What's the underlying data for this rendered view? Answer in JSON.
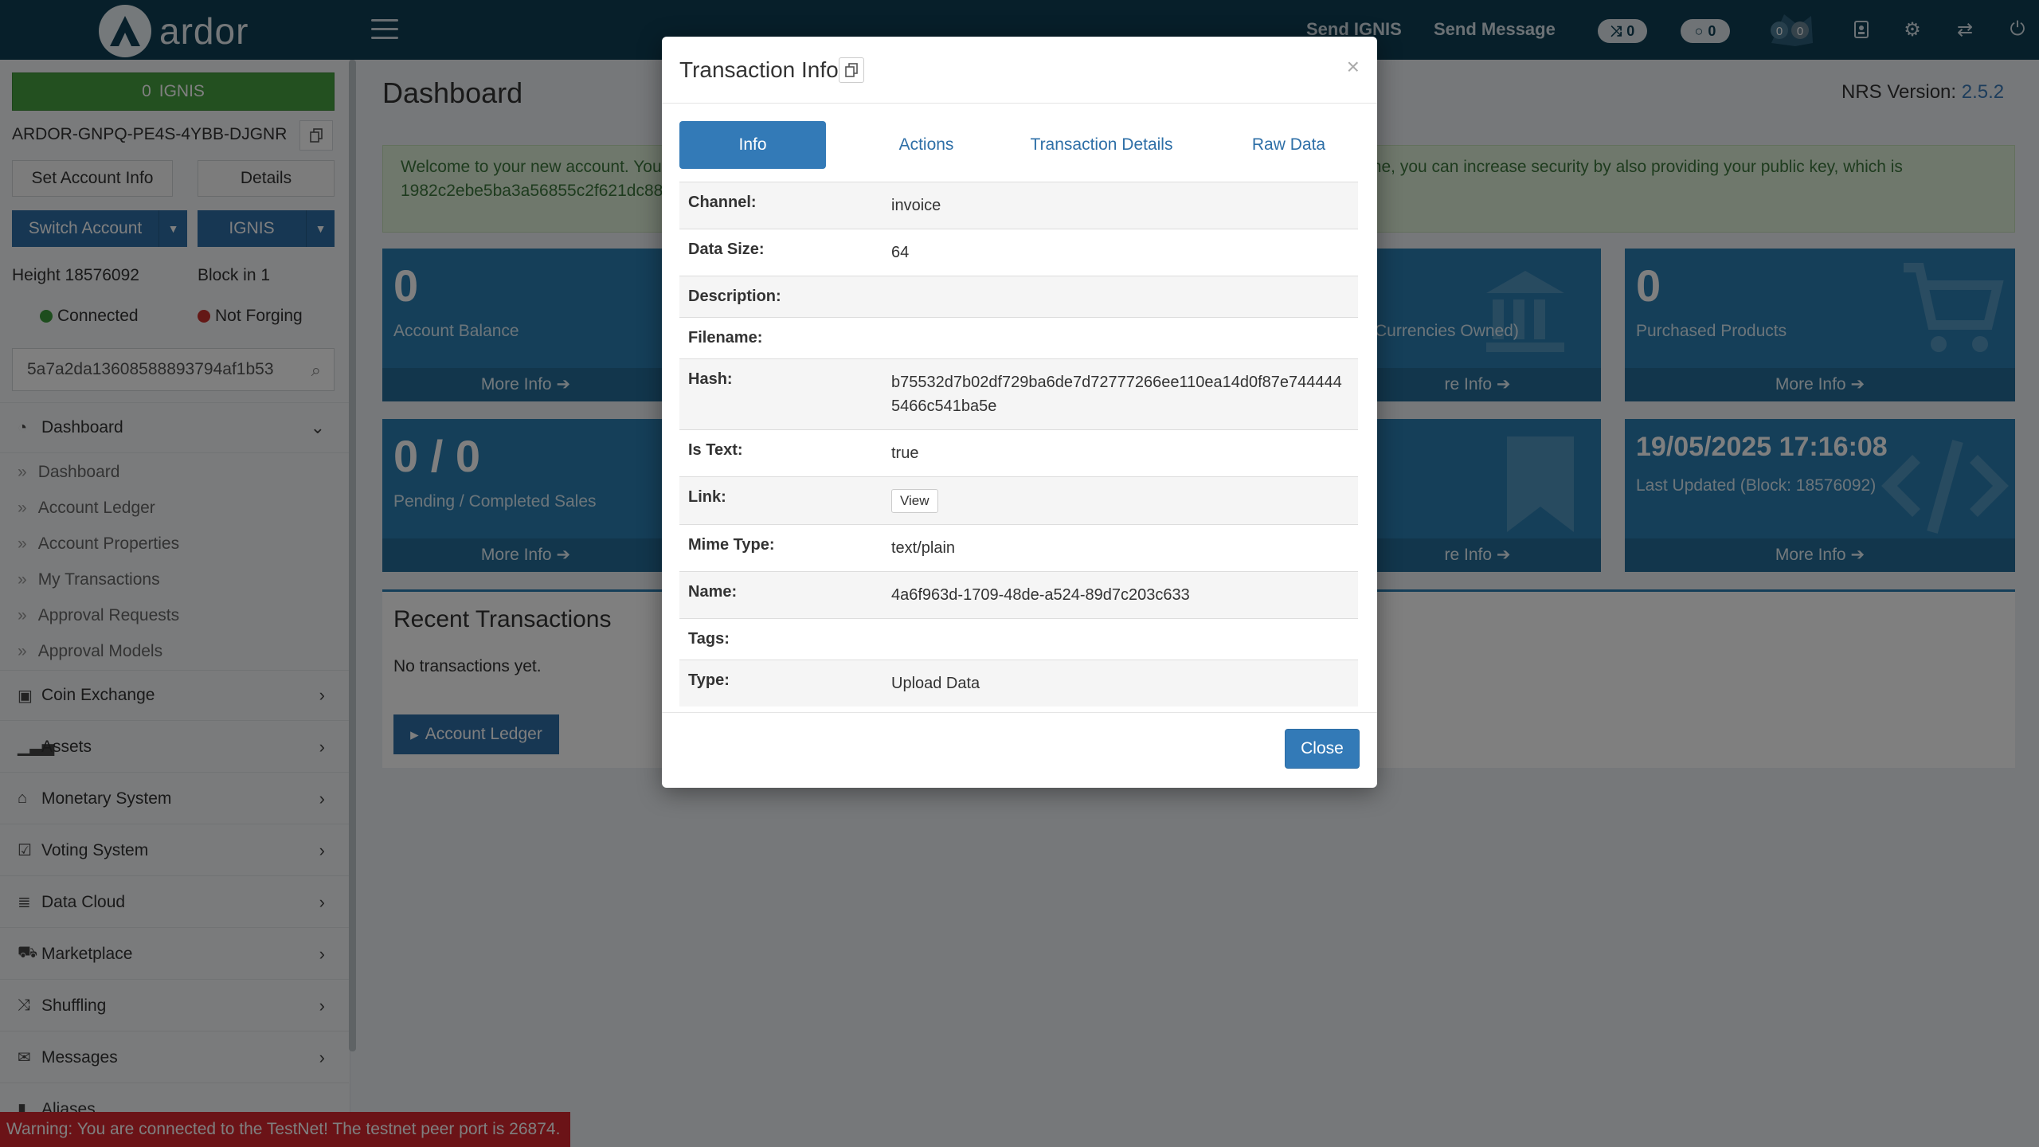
{
  "header": {
    "brand": "ardor",
    "send_ignis": "Send IGNIS",
    "send_message": "Send Message",
    "shuffle_count": "0",
    "circle_count": "0",
    "badge_a": "0",
    "badge_b": "0"
  },
  "sidebar": {
    "balance_amount": "0",
    "balance_unit": "IGNIS",
    "account_id": "ARDOR-GNPQ-PE4S-4YBB-DJGNR",
    "set_account_info": "Set Account Info",
    "details": "Details",
    "switch_account": "Switch Account",
    "chain": "IGNIS",
    "height": "Height 18576092",
    "block_in": "Block in 1",
    "connected": "Connected",
    "not_forging": "Not Forging",
    "search_value": "5a7a2da13608588893794af1b53",
    "menu": {
      "dashboard": "Dashboard",
      "sub": [
        "Dashboard",
        "Account Ledger",
        "Account Properties",
        "My Transactions",
        "Approval Requests",
        "Approval Models"
      ],
      "coin_exchange": "Coin Exchange",
      "assets": "Assets",
      "monetary_system": "Monetary System",
      "voting_system": "Voting System",
      "data_cloud": "Data Cloud",
      "marketplace": "Marketplace",
      "shuffling": "Shuffling",
      "messages": "Messages",
      "aliases": "Aliases"
    }
  },
  "warning": "Warning: You are connected to the TestNet! The testnet peer port is 26874.",
  "main": {
    "title": "Dashboard",
    "nrs_label": "NRS Version:",
    "nrs_version": "2.5.2",
    "welcome_line1": "Welcome to your new account. You",
    "welcome_line1_right": "me, you can increase security by also providing your public key, which is",
    "welcome_line2": "1982c2ebe5ba3a56855c2f621dc88",
    "tiles": {
      "balance_num": "0",
      "balance_label": "Account Balance",
      "currencies_label": "Currencies Owned)",
      "purchased_num": "0",
      "purchased_label": "Purchased Products",
      "sales_num": "0 / 0",
      "sales_label": "Pending / Completed Sales",
      "updated_num": "19/05/2025 17:16:08",
      "updated_label": "Last Updated (Block: 18576092)",
      "more_info": "More Info",
      "more_info_cut": "re Info"
    },
    "recent_title": "Recent Transactions",
    "no_transactions": "No transactions yet.",
    "account_ledger_btn": "Account Ledger"
  },
  "modal": {
    "title": "Transaction Info",
    "tabs": [
      "Info",
      "Actions",
      "Transaction Details",
      "Raw Data"
    ],
    "rows": [
      {
        "k": "Channel:",
        "v": "invoice"
      },
      {
        "k": "Data Size:",
        "v": "64"
      },
      {
        "k": "Description:",
        "v": ""
      },
      {
        "k": "Filename:",
        "v": ""
      },
      {
        "k": "Hash:",
        "v": "b75532d7b02df729ba6de7d72777266ee110ea14d0f87e7444445466c541ba5e"
      },
      {
        "k": "Is Text:",
        "v": "true"
      },
      {
        "k": "Link:",
        "v": "View"
      },
      {
        "k": "Mime Type:",
        "v": "text/plain"
      },
      {
        "k": "Name:",
        "v": "4a6f963d-1709-48de-a524-89d7c203c633"
      },
      {
        "k": "Tags:",
        "v": ""
      },
      {
        "k": "Type:",
        "v": "Upload Data"
      }
    ],
    "close": "Close"
  }
}
